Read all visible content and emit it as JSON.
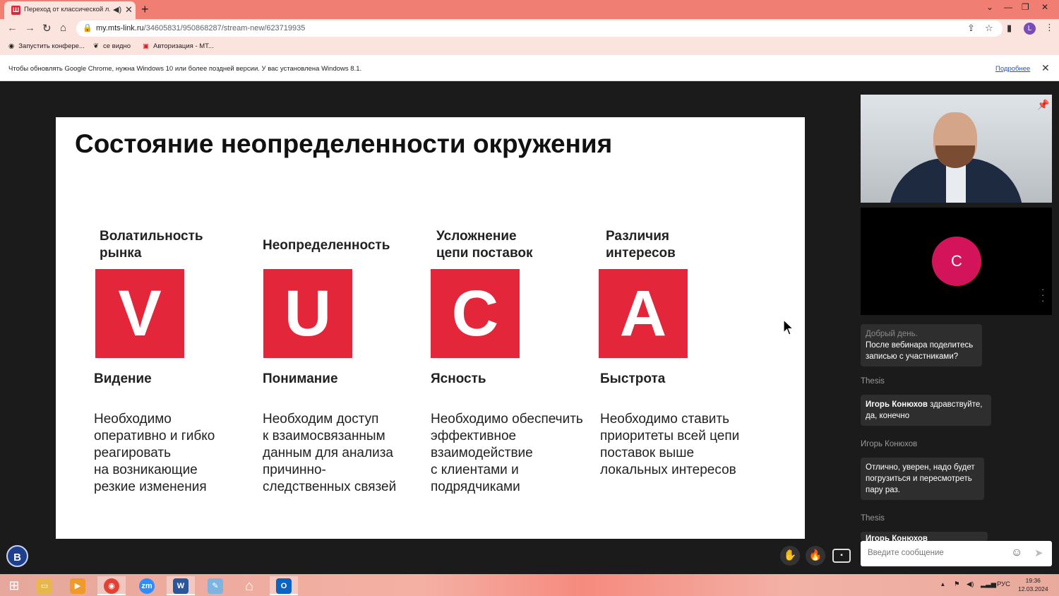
{
  "browser": {
    "tab_title": "Переход от классической л...",
    "url_host": "my.mts-link.ru",
    "url_path": "/34605831/950868287/stream-new/623719935",
    "profile_initial": "L"
  },
  "bookmarks": [
    {
      "label": "Запустить конфере...",
      "icon": "globe-icon"
    },
    {
      "label": "се видно",
      "icon": "leaf-icon"
    },
    {
      "label": "Авторизация - МТ...",
      "icon": "mts-icon"
    }
  ],
  "infobar": {
    "message": "Чтобы обновлять Google Chrome, нужна Windows 10 или более поздней версии. У вас установлена Windows 8.1.",
    "more_link": "Подробнее"
  },
  "slide": {
    "title": "Состояние неопределенности окружения",
    "columns": [
      {
        "heading": "Волатильность\nрынка",
        "letter": "V",
        "subtitle": "Видение",
        "description": "Необходимо\nоперативно и гибко\nреагировать\nна возникающие\nрезкие изменения"
      },
      {
        "heading": "Неопределенность",
        "letter": "U",
        "subtitle": "Понимание",
        "description": "Необходим доступ\nк взаимосвязанным\nданным для анализа\nпричинно-\nследственных связей"
      },
      {
        "heading": "Усложнение\nцепи поставок",
        "letter": "C",
        "subtitle": "Ясность",
        "description": "Необходимо обеспечить\nэффективное\nвзаимодействие\nс клиентами и\nподрядчиками"
      },
      {
        "heading": "Различия\nинтересов",
        "letter": "A",
        "subtitle": "Быстрота",
        "description": "Необходимо ставить\nприоритеты всей цепи\nпоставок выше\nлокальных интересов"
      }
    ]
  },
  "participants": {
    "second_initial": "С"
  },
  "chat": {
    "messages": [
      {
        "faded": "Добрый день.",
        "text": "После вебинара поделитесь записью с участниками?"
      },
      {
        "author": "Thesis",
        "mention": "Игорь Конюхов",
        "text": " здравствуйте, да, конечно"
      },
      {
        "author": "Игорь Конюхов",
        "text": "Отлично, уверен, надо будет погрузиться и пересмотреть пару раз."
      },
      {
        "author": "Thesis",
        "text": "Игорь Конюхов постараемся..."
      }
    ],
    "input_placeholder": "Введите сообщение"
  },
  "taskbar": {
    "apps": [
      "start",
      "explorer",
      "media",
      "chrome",
      "zoom",
      "word",
      "paint",
      "home",
      "outlook"
    ],
    "language": "РУС",
    "time": "19:36",
    "date": "12.03.2024"
  },
  "colors": {
    "accent_red": "#e3263a",
    "chrome_frame": "#f07e73",
    "participant_avatar": "#d4145a"
  }
}
